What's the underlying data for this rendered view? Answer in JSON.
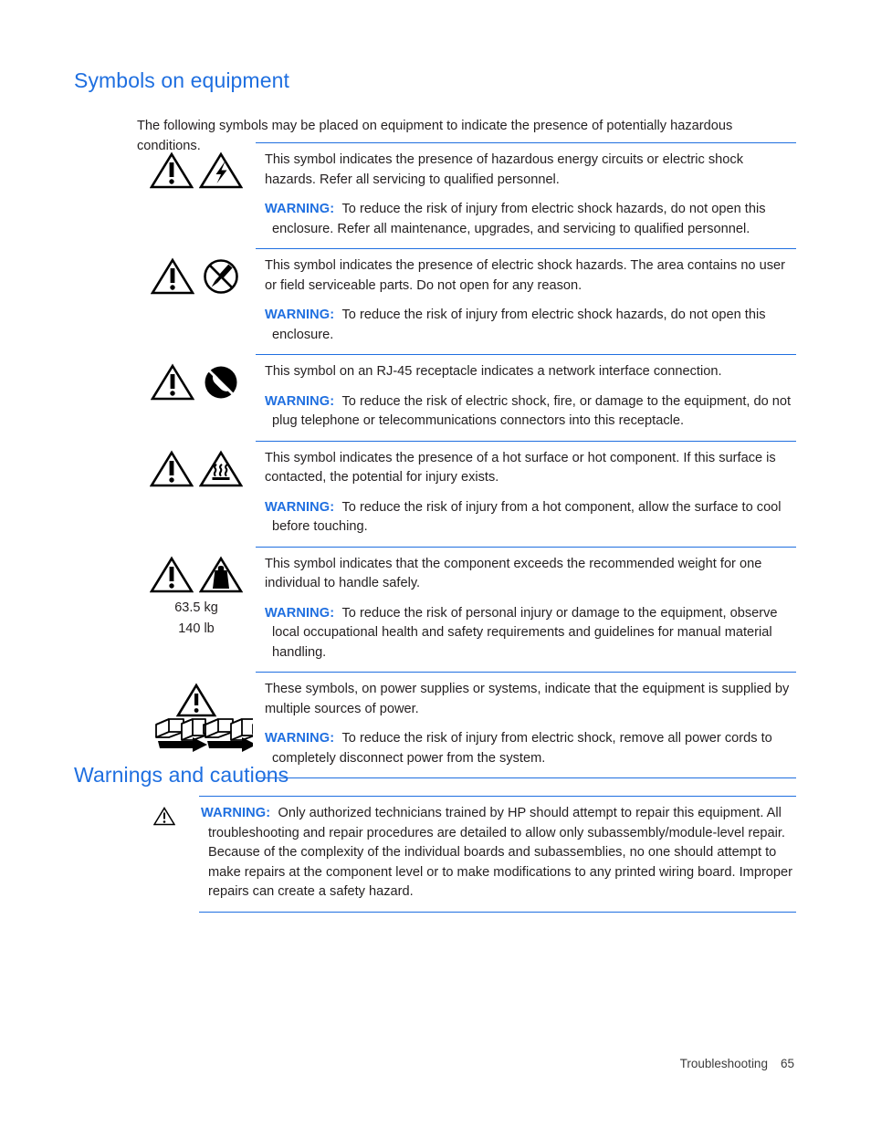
{
  "document": {
    "accent_color": "#1f6fe0",
    "text_color": "#231f20"
  },
  "sections": {
    "symbols": {
      "title": "Symbols on equipment",
      "intro": "The following symbols may be placed on equipment to indicate the presence of potentially hazardous conditions.",
      "rows": [
        {
          "icons": [
            "warning-triangle-exclamation-icon",
            "warning-triangle-lightning-icon"
          ],
          "description": "This symbol indicates the presence of hazardous energy circuits or electric shock hazards. Refer all servicing to qualified personnel.",
          "warning_label": "WARNING:",
          "warning_text": "To reduce the risk of injury from electric shock hazards, do not open this enclosure. Refer all maintenance, upgrades, and servicing to qualified personnel."
        },
        {
          "icons": [
            "warning-triangle-exclamation-icon",
            "no-screwdriver-circle-icon"
          ],
          "description": "This symbol indicates the presence of electric shock hazards. The area contains no user or field serviceable parts. Do not open for any reason.",
          "warning_label": "WARNING:",
          "warning_text": "To reduce the risk of injury from electric shock hazards, do not open this enclosure."
        },
        {
          "icons": [
            "warning-triangle-exclamation-icon",
            "no-telephone-circle-icon"
          ],
          "description": "This symbol on an RJ-45 receptacle indicates a network interface connection.",
          "warning_label": "WARNING:",
          "warning_text": "To reduce the risk of electric shock, fire, or damage to the equipment, do not plug telephone or telecommunications connectors into this receptacle."
        },
        {
          "icons": [
            "warning-triangle-exclamation-icon",
            "hot-surface-triangle-icon"
          ],
          "description": "This symbol indicates the presence of a hot surface or hot component. If this surface is contacted, the potential for injury exists.",
          "warning_label": "WARNING:",
          "warning_text": "To reduce the risk of injury from a hot component, allow the surface to cool before touching."
        },
        {
          "icons": [
            "warning-triangle-exclamation-icon",
            "heavy-weight-triangle-icon"
          ],
          "weight_metric": "63.5 kg",
          "weight_imperial": "140 lb",
          "description": "This symbol indicates that the component exceeds the recommended weight for one individual to handle safely.",
          "warning_label": "WARNING:",
          "warning_text": "To reduce the risk of personal injury or damage to the equipment, observe local occupational health and safety requirements and guidelines for manual material handling."
        },
        {
          "icons": [
            "warning-triangle-exclamation-icon",
            "multiple-power-supplies-icon"
          ],
          "description": "These symbols, on power supplies or systems, indicate that the equipment is supplied by multiple sources of power.",
          "warning_label": "WARNING:",
          "warning_text": "To reduce the risk of injury from electric shock, remove all power cords to completely disconnect power from the system."
        }
      ]
    },
    "warnings": {
      "title": "Warnings and cautions",
      "icon": "warning-triangle-exclamation-icon",
      "warning_label": "WARNING:",
      "warning_text": "Only authorized technicians trained by HP should attempt to repair this equipment. All troubleshooting and repair procedures are detailed to allow only subassembly/module-level repair. Because of the complexity of the individual boards and subassemblies, no one should attempt to make repairs at the component level or to make modifications to any printed wiring board. Improper repairs can create a safety hazard."
    }
  },
  "footer": {
    "chapter": "Troubleshooting",
    "page_number": "65"
  }
}
